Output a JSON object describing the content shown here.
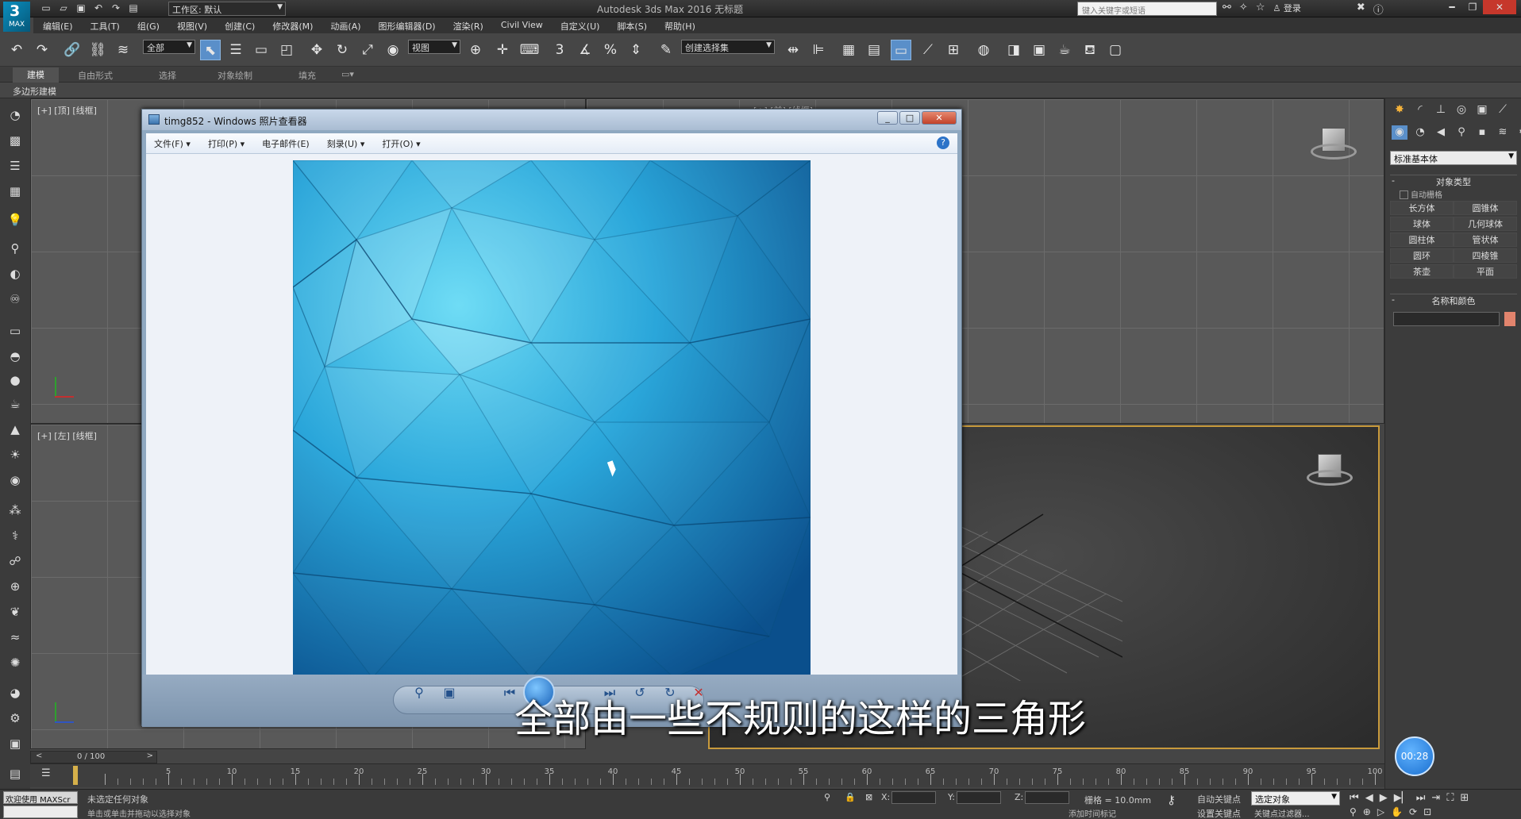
{
  "titlebar": {
    "workspace": "工作区: 默认",
    "app_title": "Autodesk 3ds Max 2016     无标题",
    "search_placeholder": "键入关键字或短语",
    "login": "登录",
    "logo_label": "MAX"
  },
  "menus": [
    "编辑(E)",
    "工具(T)",
    "组(G)",
    "视图(V)",
    "创建(C)",
    "修改器(M)",
    "动画(A)",
    "图形编辑器(D)",
    "渲染(R)",
    "Civil View",
    "自定义(U)",
    "脚本(S)",
    "帮助(H)"
  ],
  "toolbar": {
    "selection_filter": "全部",
    "ref_coord": "视图",
    "named_selection": "创建选择集",
    "snap_3": "3",
    "snap_2_5": "2.5",
    "percent": "%"
  },
  "ribbon": {
    "tabs": [
      "建模",
      "自由形式",
      "选择",
      "对象绘制",
      "填充"
    ],
    "sub_label": "多边形建模"
  },
  "viewports": {
    "top": "[+] [顶] [线框]",
    "left": "[+] [左] [线框]",
    "front_partial": "[+] [前] [线框]"
  },
  "command_panel": {
    "category": "标准基本体",
    "rollout_object_type": "对象类型",
    "auto_grid": "自动栅格",
    "objects": [
      "长方体",
      "圆锥体",
      "球体",
      "几何球体",
      "圆柱体",
      "管状体",
      "圆环",
      "四棱锥",
      "茶壶",
      "平面"
    ],
    "rollout_name_color": "名称和颜色",
    "swatch_color": "#e2846d"
  },
  "viewer": {
    "title": "timg852 - Windows 照片查看器",
    "menu": [
      "文件(F) ▾",
      "打印(P) ▾",
      "电子邮件(E)",
      "刻录(U) ▾",
      "打开(O) ▾"
    ],
    "help": "?"
  },
  "subtitle": "全部由一些不规则的这样的三角形",
  "timer": "00:28",
  "timeline": {
    "slider_value": "0 / 100",
    "ticks": [
      5,
      10,
      15,
      20,
      25,
      30,
      35,
      40,
      45,
      50,
      55,
      60,
      65,
      70,
      75,
      80,
      85,
      90,
      95,
      100
    ]
  },
  "status": {
    "maxscript": "欢迎使用  MAXScr",
    "line1": "未选定任何对象",
    "line2": "单击或单击并拖动以选择对象",
    "x_label": "X:",
    "y_label": "Y:",
    "z_label": "Z:",
    "grid": "栅格 = 10.0mm",
    "auto_key": "自动关键点",
    "set_key": "设置关键点",
    "selected": "选定对象",
    "key_filters": "关键点过滤器...",
    "add_time_tag": "添加时间标记"
  }
}
